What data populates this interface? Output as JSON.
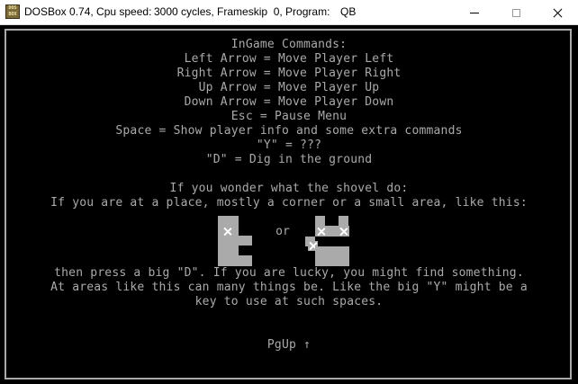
{
  "window": {
    "icon_text": "DOS BOX",
    "title_app": "DOSBox 0.74, Cpu speed:",
    "title_cycles": "3000 cycles, Frameskip  0, Program:",
    "title_program": "QB",
    "min_icon": "minimize-icon",
    "max_icon": "maximize-icon",
    "close_icon": "close-icon"
  },
  "screen": {
    "lines": [
      "InGame Commands:",
      "Left Arrow = Move Player Left",
      "Right Arrow = Move Player Right",
      "Up Arrow = Move Player Up",
      "Down Arrow = Move Player Down",
      "Esc = Pause Menu",
      "Space = Show player info and some extra commands",
      "\"Y\" = ???",
      "\"D\" = Dig in the ground",
      "If you wonder what the shovel do:",
      "If you are at a place, mostly a corner or a small area, like this:",
      "then press a big \"D\". If you are lucky, you might find something.",
      "At areas like this can many things be. Like the big \"Y\" might be a",
      "key to use at such spaces."
    ],
    "or_label": "or",
    "footer": "PgUp ↑",
    "colors": {
      "background": "#000000",
      "text": "#aaaaaa"
    }
  }
}
